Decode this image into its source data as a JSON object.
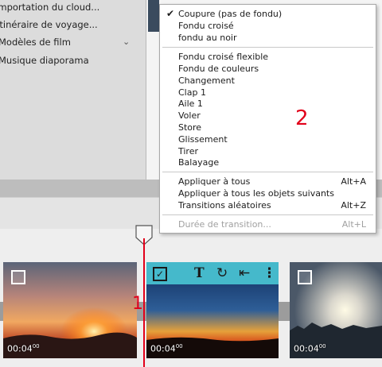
{
  "sidebar": {
    "items": [
      {
        "label": "Importation du cloud..."
      },
      {
        "label": "Itinéraire de voyage..."
      },
      {
        "label": "Modèles de film"
      },
      {
        "label": "Musique diaporama"
      }
    ]
  },
  "menu": {
    "groups": [
      [
        {
          "label": "Coupure (pas de fondu)",
          "checked": true
        },
        {
          "label": "Fondu croisé"
        },
        {
          "label": "fondu au noir"
        }
      ],
      [
        {
          "label": "Fondu croisé flexible"
        },
        {
          "label": "Fondu de couleurs"
        },
        {
          "label": "Changement"
        },
        {
          "label": "Clap 1"
        },
        {
          "label": "Aile 1"
        },
        {
          "label": "Voler"
        },
        {
          "label": "Store"
        },
        {
          "label": "Glissement"
        },
        {
          "label": "Tirer"
        },
        {
          "label": "Balayage"
        }
      ],
      [
        {
          "label": "Appliquer à tous",
          "shortcut": "Alt+A"
        },
        {
          "label": "Appliquer à tous les objets suivants"
        },
        {
          "label": "Transitions aléatoires",
          "shortcut": "Alt+Z"
        }
      ],
      [
        {
          "label": "Durée de transition...",
          "shortcut": "Alt+L",
          "disabled": true
        }
      ]
    ]
  },
  "annotations": {
    "marker_1": "1",
    "marker_2": "2"
  },
  "timeline": {
    "clips": [
      {
        "time_main": "00:04",
        "time_frac": "00",
        "selected": false
      },
      {
        "time_main": "00:04",
        "time_frac": "00",
        "selected": true
      },
      {
        "time_main": "00:04",
        "time_frac": "00",
        "selected": false
      }
    ]
  },
  "colors": {
    "accent": "#45b9cb",
    "playhead": "#e2001a",
    "annotation": "#e2001a"
  },
  "icons": {
    "selected_clip_toolbar": [
      "checkbox-checked-icon",
      "text-icon",
      "rotate-icon",
      "trim-icon",
      "more-vertical-icon"
    ]
  }
}
